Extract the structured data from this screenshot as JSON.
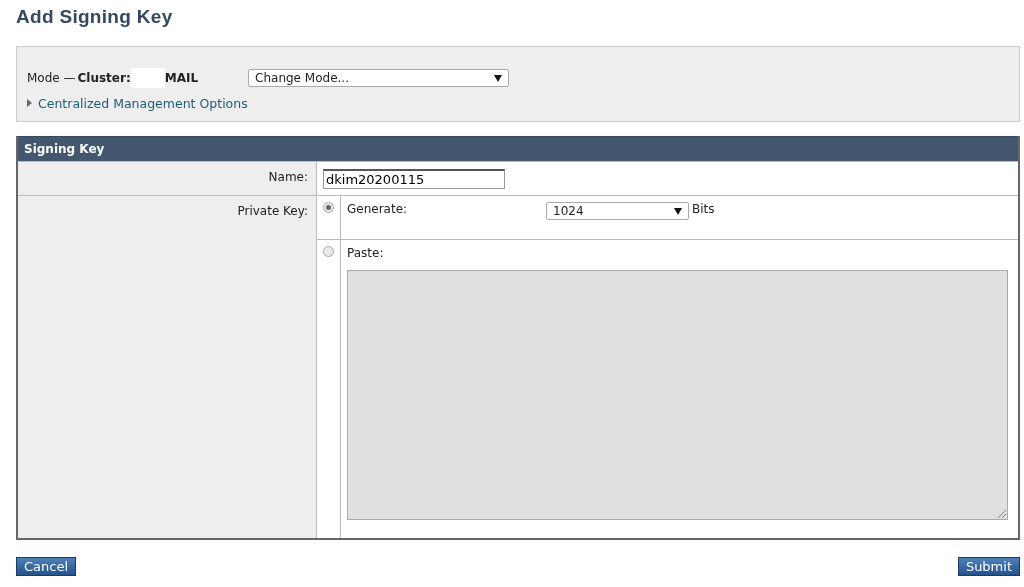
{
  "page_title": "Add Signing Key",
  "mode_panel": {
    "mode_label": "Mode —",
    "cluster_label": "Cluster:",
    "cluster_name": "MAIL",
    "mode_select": {
      "value": "Change Mode..."
    },
    "options_link": {
      "label": "Centralized Management Options",
      "expanded": false
    }
  },
  "signing_key": {
    "header": "Signing Key",
    "name_field": {
      "label": "Name:",
      "value": "dkim20200115"
    },
    "private_key": {
      "label": "Private Key:",
      "options": [
        {
          "kind": "generate",
          "label": "Generate:",
          "selected": true,
          "size_select": {
            "value": "1024"
          },
          "unit": "Bits"
        },
        {
          "kind": "paste",
          "label": "Paste:",
          "selected": false
        }
      ]
    }
  },
  "buttons": {
    "cancel": "Cancel",
    "submit": "Submit"
  }
}
